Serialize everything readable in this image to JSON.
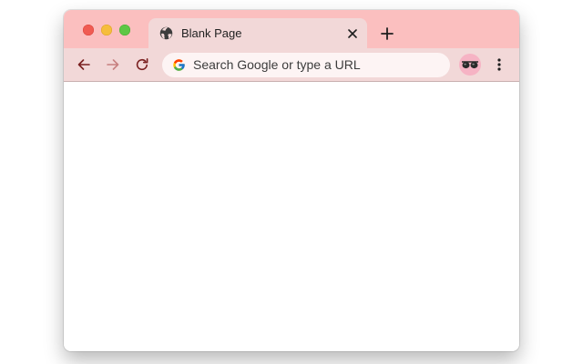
{
  "window": {
    "controls": [
      "close",
      "minimize",
      "maximize"
    ],
    "theme_colors": {
      "frame": "#fbbfbf",
      "toolbar": "#f2d8d8",
      "omnibox": "#fdf4f4",
      "nav_icon_active": "#7a1f1f",
      "nav_icon_disabled": "#c77f7f"
    }
  },
  "tabs": [
    {
      "title": "Blank Page",
      "favicon": "globe-icon",
      "active": true
    }
  ],
  "new_tab_icon": "plus-icon",
  "toolbar": {
    "back_icon": "arrow-left-icon",
    "forward_icon": "arrow-right-icon",
    "forward_enabled": false,
    "reload_icon": "reload-icon",
    "omnibox": {
      "search_engine_icon": "google-g-icon",
      "placeholder": "Search Google or type a URL"
    },
    "profile_icon": "sunglasses-avatar-icon",
    "menu_icon": "more-vertical-icon"
  },
  "page": {
    "content": ""
  }
}
